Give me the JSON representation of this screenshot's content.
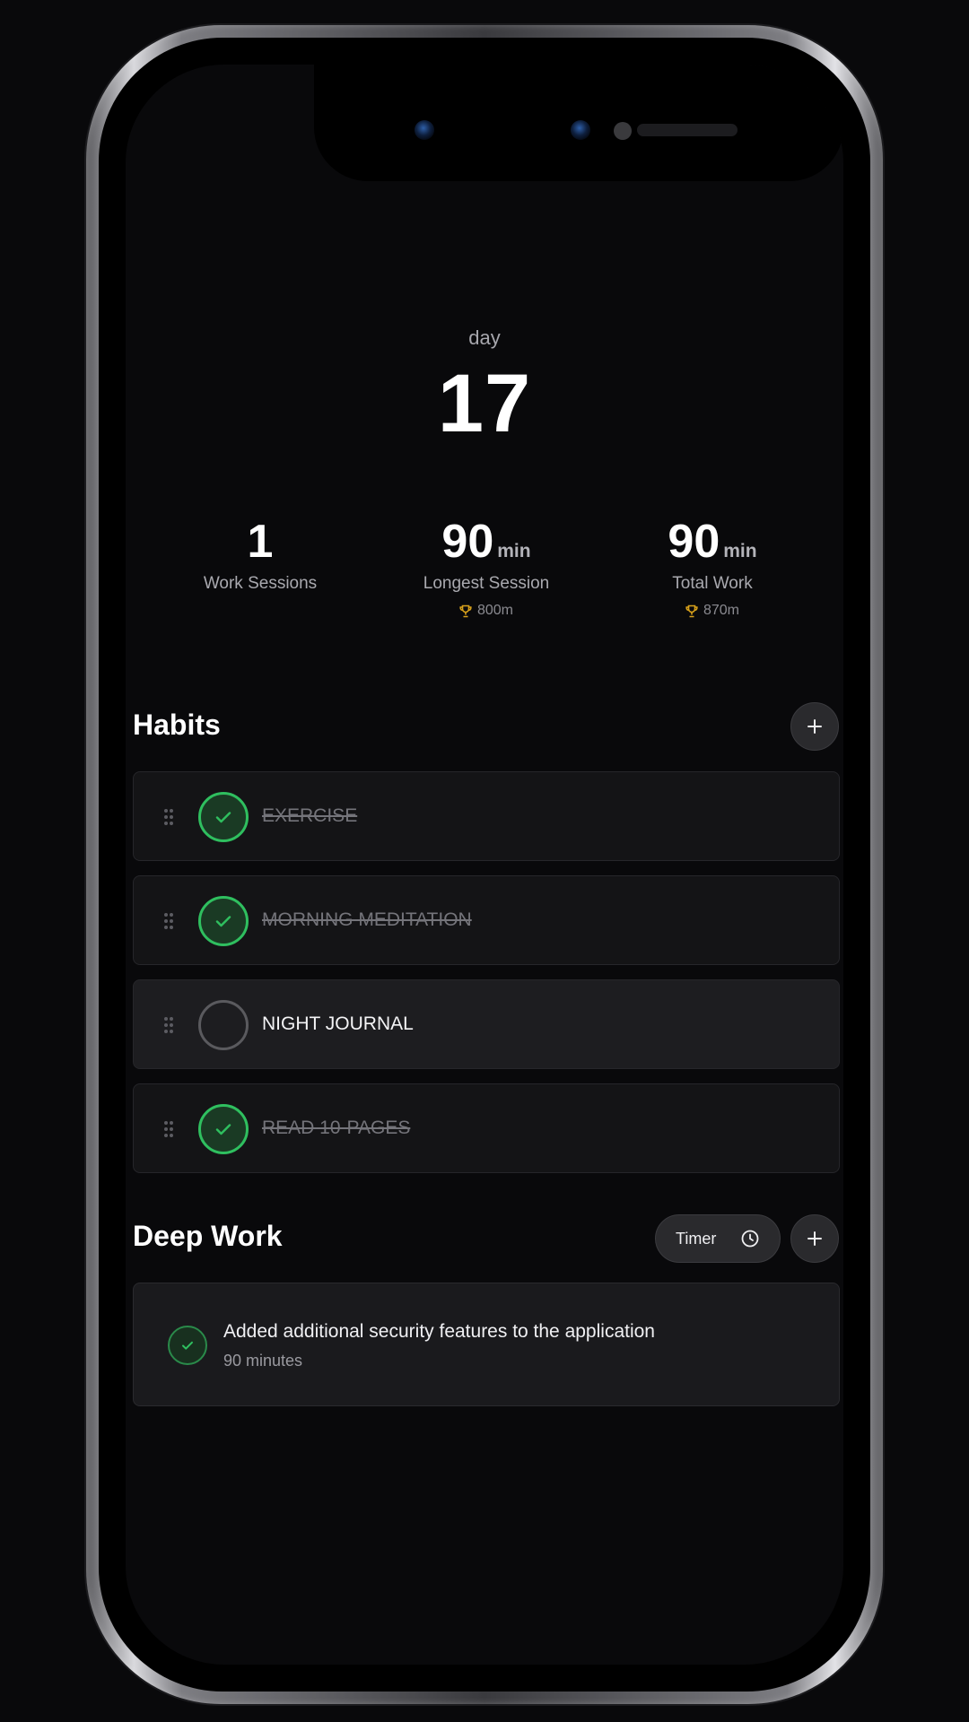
{
  "header": {
    "day_label": "day",
    "day_number": "17"
  },
  "stats": [
    {
      "value": "1",
      "unit": "",
      "label": "Work Sessions",
      "record": ""
    },
    {
      "value": "90",
      "unit": "min",
      "label": "Longest Session",
      "record": "800m"
    },
    {
      "value": "90",
      "unit": "min",
      "label": "Total Work",
      "record": "870m"
    }
  ],
  "habits": {
    "title": "Habits",
    "items": [
      {
        "label": "EXERCISE",
        "done": true
      },
      {
        "label": "MORNING MEDITATION",
        "done": true
      },
      {
        "label": "NIGHT JOURNAL",
        "done": false
      },
      {
        "label": "READ 10-PAGES",
        "done": true
      }
    ]
  },
  "deep_work": {
    "title": "Deep Work",
    "timer_label": "Timer",
    "sessions": [
      {
        "title": "Added additional security features to the application",
        "duration": "90 minutes",
        "done": true
      }
    ]
  },
  "colors": {
    "accent_green": "#2fbf5f",
    "trophy_gold": "#d9a21b",
    "background": "#09090b"
  },
  "icons": {
    "add": "plus-icon",
    "timer": "clock-icon",
    "check": "check-icon",
    "drag": "drag-handle-icon",
    "record": "trophy-icon"
  }
}
